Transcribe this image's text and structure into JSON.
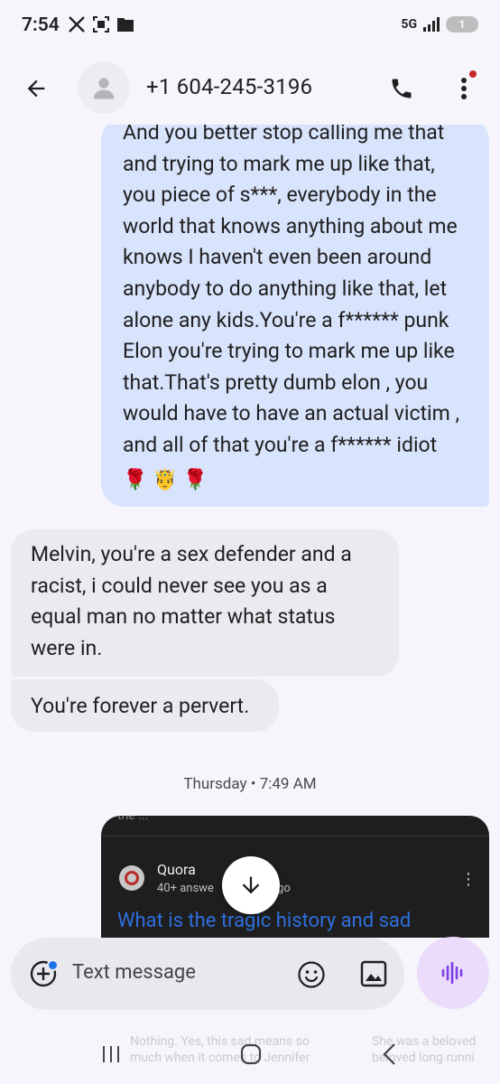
{
  "status_bar": {
    "time": "7:54",
    "network": "5G",
    "battery": "1"
  },
  "header": {
    "contact": "+1 604-245-3196"
  },
  "messages": {
    "outgoing_text": "And you better stop calling me that\nand trying to mark me up like that,\nyou piece of s***, everybody in the\nworld that knows anything about me\nknows I haven't even been around\nanybody to do anything like that, let\nalone any kids.You're a f****** punk\nElon you're trying to mark me up like\nthat.That's pretty dumb elon , you\nwould have to have an actual victim ,\nand all of that you're a f****** idiot",
    "outgoing_emojis": [
      "🌹",
      "🤴",
      "🌹"
    ],
    "incoming_1": "Melvin, you're a sex defender and a\nracist, i could never see you as a\nequal man no matter what status\nwere in.",
    "incoming_2": "You're forever a pervert.",
    "timestamp": "Thursday • 7:49 AM"
  },
  "shared_screenshot": {
    "top_fragment": "the ...",
    "source": "Quora",
    "subtitle_left": "40+ answe",
    "subtitle_right": "ago",
    "title": "What is the tragic history and sad",
    "faint_left": "Nothing. Yes, this sad means so\nmuch when it comes to Jennifer",
    "faint_right": "She was a beloved\nbeloved long runni"
  },
  "composer": {
    "placeholder": "Text message"
  },
  "colors": {
    "outgoing_bubble": "#d8e3fc",
    "incoming_bubble": "#ebeaf0",
    "voice_button": "#ecdcfb",
    "accent": "#1a73e8"
  }
}
